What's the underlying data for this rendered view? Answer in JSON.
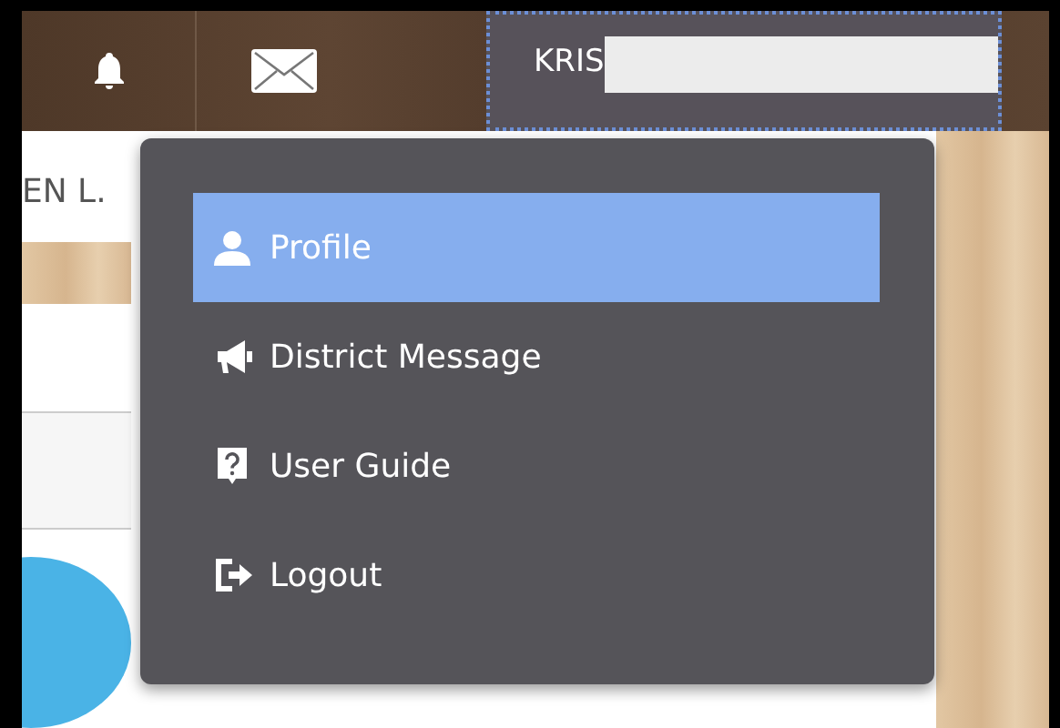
{
  "topbar": {
    "user_name": "KRIS"
  },
  "background": {
    "name_fragment": "EN L."
  },
  "menu": {
    "items": [
      {
        "label": "Profile",
        "selected": true
      },
      {
        "label": "District Message",
        "selected": false
      },
      {
        "label": "User Guide",
        "selected": false
      },
      {
        "label": "Logout",
        "selected": false
      }
    ]
  }
}
